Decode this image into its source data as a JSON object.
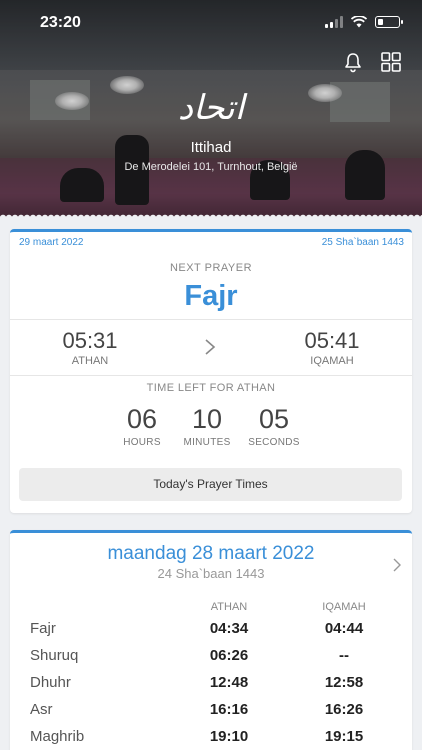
{
  "status_bar": {
    "time": "23:20"
  },
  "header": {
    "arabic_name": "اتحاد",
    "name": "Ittihad",
    "address": "De Merodelei 101, Turnhout, België"
  },
  "next_prayer_card": {
    "gregorian_date": "29 maart 2022",
    "hijri_date": "25 Sha`baan 1443",
    "next_label": "NEXT PRAYER",
    "prayer": "Fajr",
    "athan_time": "05:31",
    "athan_label": "ATHAN",
    "iqamah_time": "05:41",
    "iqamah_label": "IQAMAH",
    "time_left_label": "TIME LEFT FOR ATHAN",
    "hours": "06",
    "hours_label": "HOURS",
    "minutes": "10",
    "minutes_label": "MINUTES",
    "seconds": "05",
    "seconds_label": "SECONDS",
    "button_label": "Today's Prayer Times"
  },
  "daily_card": {
    "day_title": "maandag 28 maart 2022",
    "hijri": "24 Sha`baan 1443",
    "col_athan": "ATHAN",
    "col_iqamah": "IQAMAH",
    "rows": [
      {
        "name": "Fajr",
        "athan": "04:34",
        "iqamah": "04:44"
      },
      {
        "name": "Shuruq",
        "athan": "06:26",
        "iqamah": "--"
      },
      {
        "name": "Dhuhr",
        "athan": "12:48",
        "iqamah": "12:58"
      },
      {
        "name": "Asr",
        "athan": "16:16",
        "iqamah": "16:26"
      },
      {
        "name": "Maghrib",
        "athan": "19:10",
        "iqamah": "19:15"
      }
    ]
  },
  "icons": {
    "bell": "bell-icon",
    "grid": "grid-icon",
    "chevron": "chevron-right-icon"
  },
  "colors": {
    "accent": "#3a8fd8"
  }
}
